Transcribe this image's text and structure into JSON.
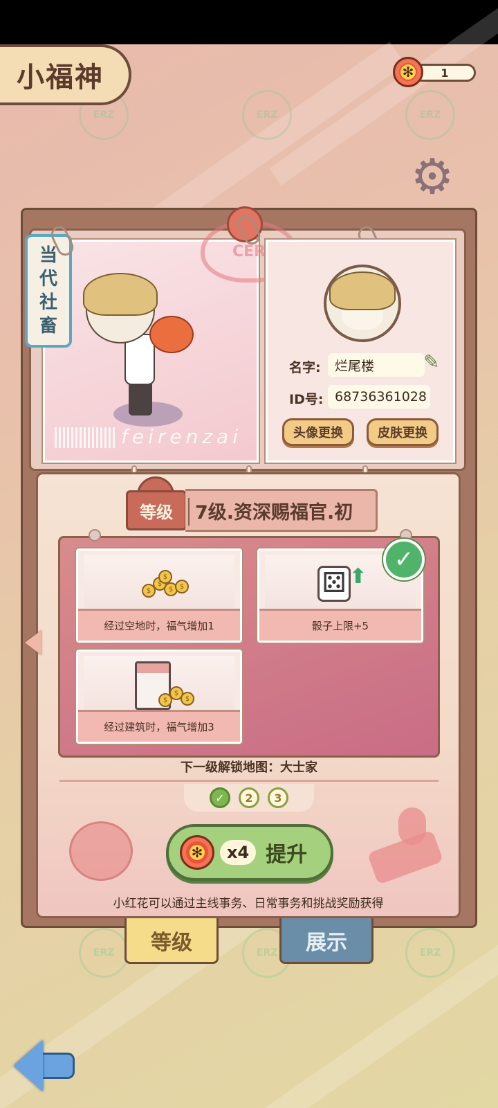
{
  "header": {
    "title": "小福神",
    "currency": {
      "icon": "red-flower-icon",
      "value": "1"
    }
  },
  "profile": {
    "badge_chars": [
      "当",
      "代",
      "社",
      "畜"
    ],
    "photo_signature": "feirenzai",
    "stamp_text": "CER",
    "name_label": "名字:",
    "name_value": "烂尾楼",
    "id_label": "ID号:",
    "id_value": "68736361028",
    "change_avatar_label": "头像更换",
    "change_skin_label": "皮肤更换"
  },
  "level": {
    "tag_label": "等级",
    "title": "7级.资深赐福官.初",
    "rewards": [
      {
        "caption": "经过空地时，福气增加1",
        "icon": "coins-icon",
        "claimed": false
      },
      {
        "caption": "骰子上限+5",
        "icon": "dice-upgrade-icon",
        "claimed": true
      },
      {
        "caption": "经过建筑时，福气增加3",
        "icon": "building-coins-icon",
        "claimed": false
      }
    ],
    "unlock_text": "下一级解锁地图：大士家",
    "steps": [
      {
        "label": "✓",
        "done": true
      },
      {
        "label": "2",
        "done": false
      },
      {
        "label": "3",
        "done": false
      }
    ],
    "upgrade": {
      "cost": "x4",
      "label": "提升"
    },
    "hint": "小红花可以通过主线事务、日常事务和挑战奖励获得"
  },
  "tabs": {
    "level": "等级",
    "show": "展示"
  },
  "colors": {
    "background_top": "#e9b9ad",
    "background_bottom": "#e2d8a4",
    "folder": "#a57763",
    "accent_green": "#a5d17e",
    "badge_blue": "#5aa7c8"
  }
}
